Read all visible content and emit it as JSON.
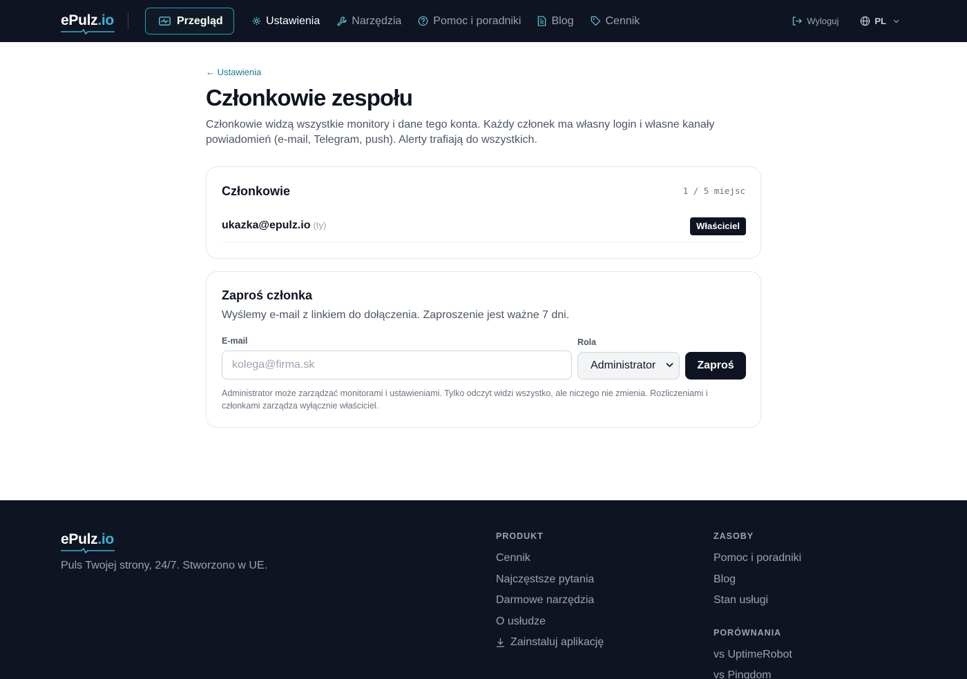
{
  "brand": {
    "name": "ePulz",
    "tld": ".io"
  },
  "nav": {
    "overview_label": "Przegląd",
    "links": [
      {
        "label": "Ustawienia",
        "icon": "gear-icon",
        "active": true
      },
      {
        "label": "Narzędzia",
        "icon": "wrench-icon",
        "active": false
      },
      {
        "label": "Pomoc i poradniki",
        "icon": "help-circle-icon",
        "active": false
      },
      {
        "label": "Blog",
        "icon": "document-icon",
        "active": false
      },
      {
        "label": "Cennik",
        "icon": "tag-icon",
        "active": false
      }
    ],
    "logout_label": "Wyloguj",
    "lang_label": "PL"
  },
  "page": {
    "back_label": "← Ustawienia",
    "title": "Członkowie zespołu",
    "description": "Członkowie widzą wszystkie monitory i dane tego konta. Każdy członek ma własny login i własne kanały powiadomień (e-mail, Telegram, push). Alerty trafiają do wszystkich."
  },
  "members": {
    "title": "Członkowie",
    "seats": "1 / 5 miejsc",
    "rows": [
      {
        "email": "ukazka@epulz.io",
        "you": "(ty)",
        "role": "Właściciel"
      }
    ]
  },
  "invite": {
    "title": "Zaproś członka",
    "description": "Wyślemy e-mail z linkiem do dołączenia. Zaproszenie jest ważne 7 dni.",
    "email_label": "E-mail",
    "email_placeholder": "kolega@firma.sk",
    "email_value": "",
    "role_label": "Rola",
    "role_selected": "Administrator",
    "submit_label": "Zaproś",
    "note": "Administrator może zarządzać monitorami i ustawieniami. Tylko odczyt widzi wszystko, ale niczego nie zmienia. Rozliczeniami i członkami zarządza wyłącznie właściciel."
  },
  "footer": {
    "tagline": "Puls Twojej strony, 24/7. Stworzono w UE.",
    "product": {
      "heading": "Produkt",
      "links": [
        "Cennik",
        "Najczęstsze pytania",
        "Darmowe narzędzia",
        "O usłudze",
        "Zainstaluj aplikację"
      ]
    },
    "resources": {
      "heading": "Zasoby",
      "links": [
        "Pomoc i poradniki",
        "Blog",
        "Stan usługi"
      ]
    },
    "comparisons": {
      "heading": "Porównania",
      "links": [
        "vs UptimeRobot",
        "vs Pingdom"
      ]
    }
  },
  "colors": {
    "nav_bg": "#0f1422",
    "accent": "#1fa3b9",
    "link": "#157a8c",
    "primary_button": "#0f1422"
  }
}
